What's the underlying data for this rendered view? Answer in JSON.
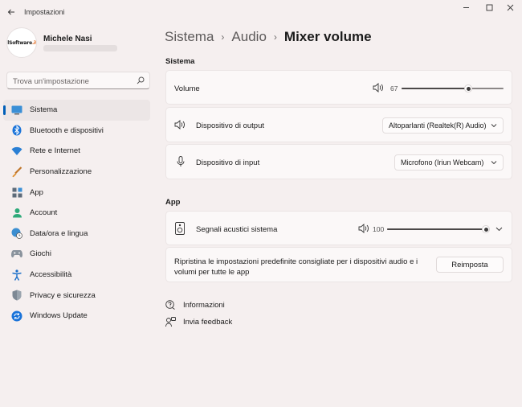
{
  "window": {
    "title": "Impostazioni",
    "minimize_glyph": "—",
    "maximize_glyph": "☐",
    "close_glyph": "✕"
  },
  "profile": {
    "name": "Michele Nasi",
    "logo_text": "ilSoftware.it"
  },
  "search": {
    "placeholder": "Trova un'impostazione"
  },
  "sidebar": {
    "items": [
      {
        "label": "Sistema",
        "icon": "monitor-icon",
        "active": true
      },
      {
        "label": "Bluetooth e dispositivi",
        "icon": "bluetooth-icon"
      },
      {
        "label": "Rete e Internet",
        "icon": "wifi-icon"
      },
      {
        "label": "Personalizzazione",
        "icon": "brush-icon"
      },
      {
        "label": "App",
        "icon": "apps-icon"
      },
      {
        "label": "Account",
        "icon": "person-icon"
      },
      {
        "label": "Data/ora e lingua",
        "icon": "globe-clock-icon"
      },
      {
        "label": "Giochi",
        "icon": "gamepad-icon"
      },
      {
        "label": "Accessibilità",
        "icon": "accessibility-icon"
      },
      {
        "label": "Privacy e sicurezza",
        "icon": "shield-icon"
      },
      {
        "label": "Windows Update",
        "icon": "update-icon"
      }
    ]
  },
  "breadcrumb": {
    "items": [
      "Sistema",
      "Audio",
      "Mixer volume"
    ]
  },
  "sistema_section": {
    "title": "Sistema",
    "volume": {
      "label": "Volume",
      "value": "67",
      "level": 0.67
    },
    "output": {
      "label": "Dispositivo di output",
      "selected": "Altoparlanti (Realtek(R) Audio)"
    },
    "input": {
      "label": "Dispositivo di input",
      "selected": "Microfono (Iriun Webcam)"
    }
  },
  "app_section": {
    "title": "App",
    "system_sounds": {
      "label": "Segnali acustici sistema",
      "value": "100",
      "level": 1.0
    },
    "reset": {
      "text_line1": "Ripristina le impostazioni predefinite consigliate per i dispositivi audio e i",
      "text_line2": "volumi per tutte le app",
      "button_label": "Reimposta"
    }
  },
  "links": {
    "info": "Informazioni",
    "feedback": "Invia feedback"
  },
  "colors": {
    "accent": "#005fb8",
    "background": "#f5efef",
    "card": "#fbf8f8"
  }
}
